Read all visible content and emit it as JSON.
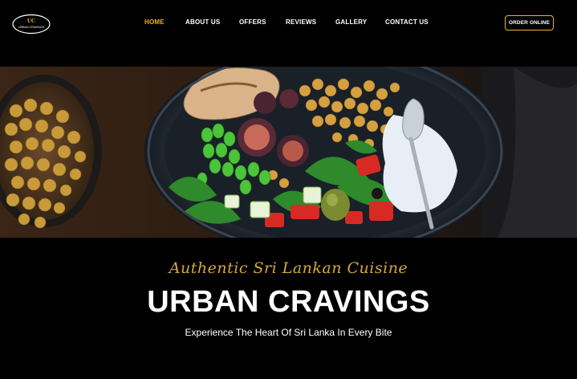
{
  "brand": {
    "logo_initials": "UC",
    "logo_text": "URBAN CRAVINGS",
    "accent_color": "#f0b324"
  },
  "nav": {
    "items": [
      {
        "label": "HOME",
        "active": true
      },
      {
        "label": "ABOUT US",
        "active": false
      },
      {
        "label": "OFFERS",
        "active": false
      },
      {
        "label": "REVIEWS",
        "active": false
      },
      {
        "label": "GALLERY",
        "active": false
      },
      {
        "label": "CONTACT US",
        "active": false
      }
    ],
    "order_button": "ORDER ONLINE"
  },
  "hero": {
    "tagline": "Authentic Sri Lankan Cuisine",
    "title": "URBAN CRAVINGS",
    "subtitle": "Experience The Heart Of Sri Lanka In Every Bite"
  }
}
